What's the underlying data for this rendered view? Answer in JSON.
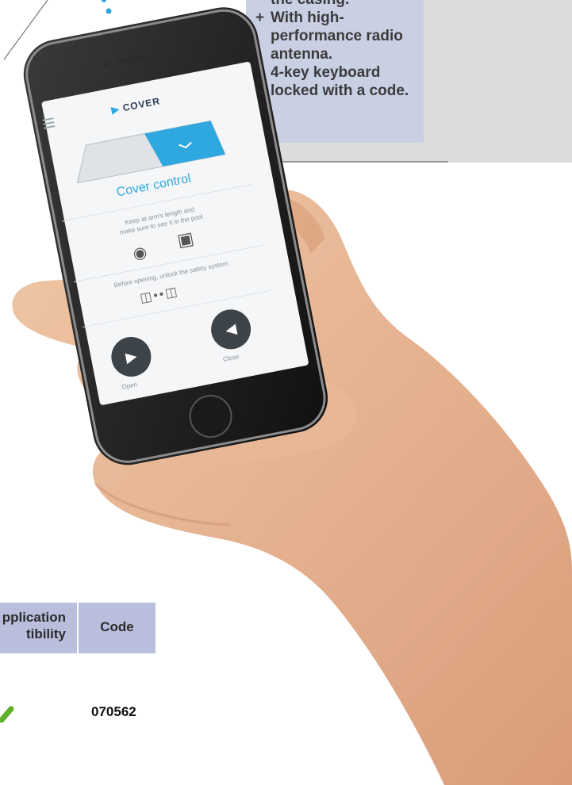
{
  "features": [
    {
      "bullet": "+",
      "text": "the casing."
    },
    {
      "bullet": "+",
      "text": "With high-performance radio antenna."
    },
    {
      "bullet": "+",
      "text": "4-key keyboard locked with a code."
    }
  ],
  "table": {
    "headers": {
      "application": "pplication\ntibility",
      "code": "Code"
    },
    "rows": [
      {
        "compatible": true,
        "code": "070562"
      }
    ]
  },
  "phone_app": {
    "logo": "COVER",
    "title": "Cover control",
    "instruction_1": "Keep at arm's length and\nmake sure to see it in the pool",
    "instruction_2": "Before opening, unlock the safety system",
    "open_label": "Open",
    "close_label": "Close"
  },
  "colors": {
    "callout_bg": "#c9d0e4",
    "table_header_bg": "#b9bedd",
    "check_green": "#5fb02c",
    "app_accent": "#2fa8e0"
  }
}
